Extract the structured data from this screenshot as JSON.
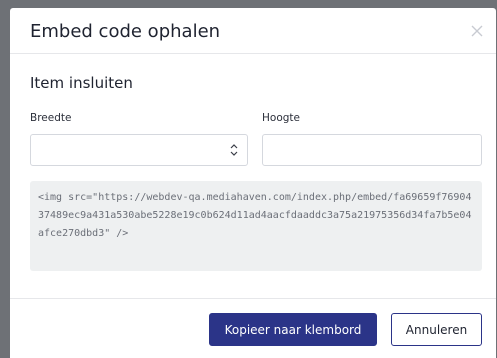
{
  "modal": {
    "title": "Embed code ophalen",
    "close_icon": "close-icon"
  },
  "embed": {
    "section_title": "Item insluiten",
    "width_label": "Breedte",
    "width_value": "",
    "height_label": "Hoogte",
    "height_value": "",
    "stepper_icon": "stepper-icon",
    "code": "<img src=\"https://webdev-qa.mediahaven.com/index.php/embed/fa69659f7690437489ec9a431a530abe5228e19c0b624d11ad4aacfdaaddc3a75a21975356d34fa7b5e04afce270dbd3\" />"
  },
  "footer": {
    "copy_label": "Kopieer naar klembord",
    "cancel_label": "Annuleren"
  },
  "colors": {
    "primary": "#2b3488",
    "backdrop": "#8a8d92",
    "code_background": "#eef0f1"
  }
}
